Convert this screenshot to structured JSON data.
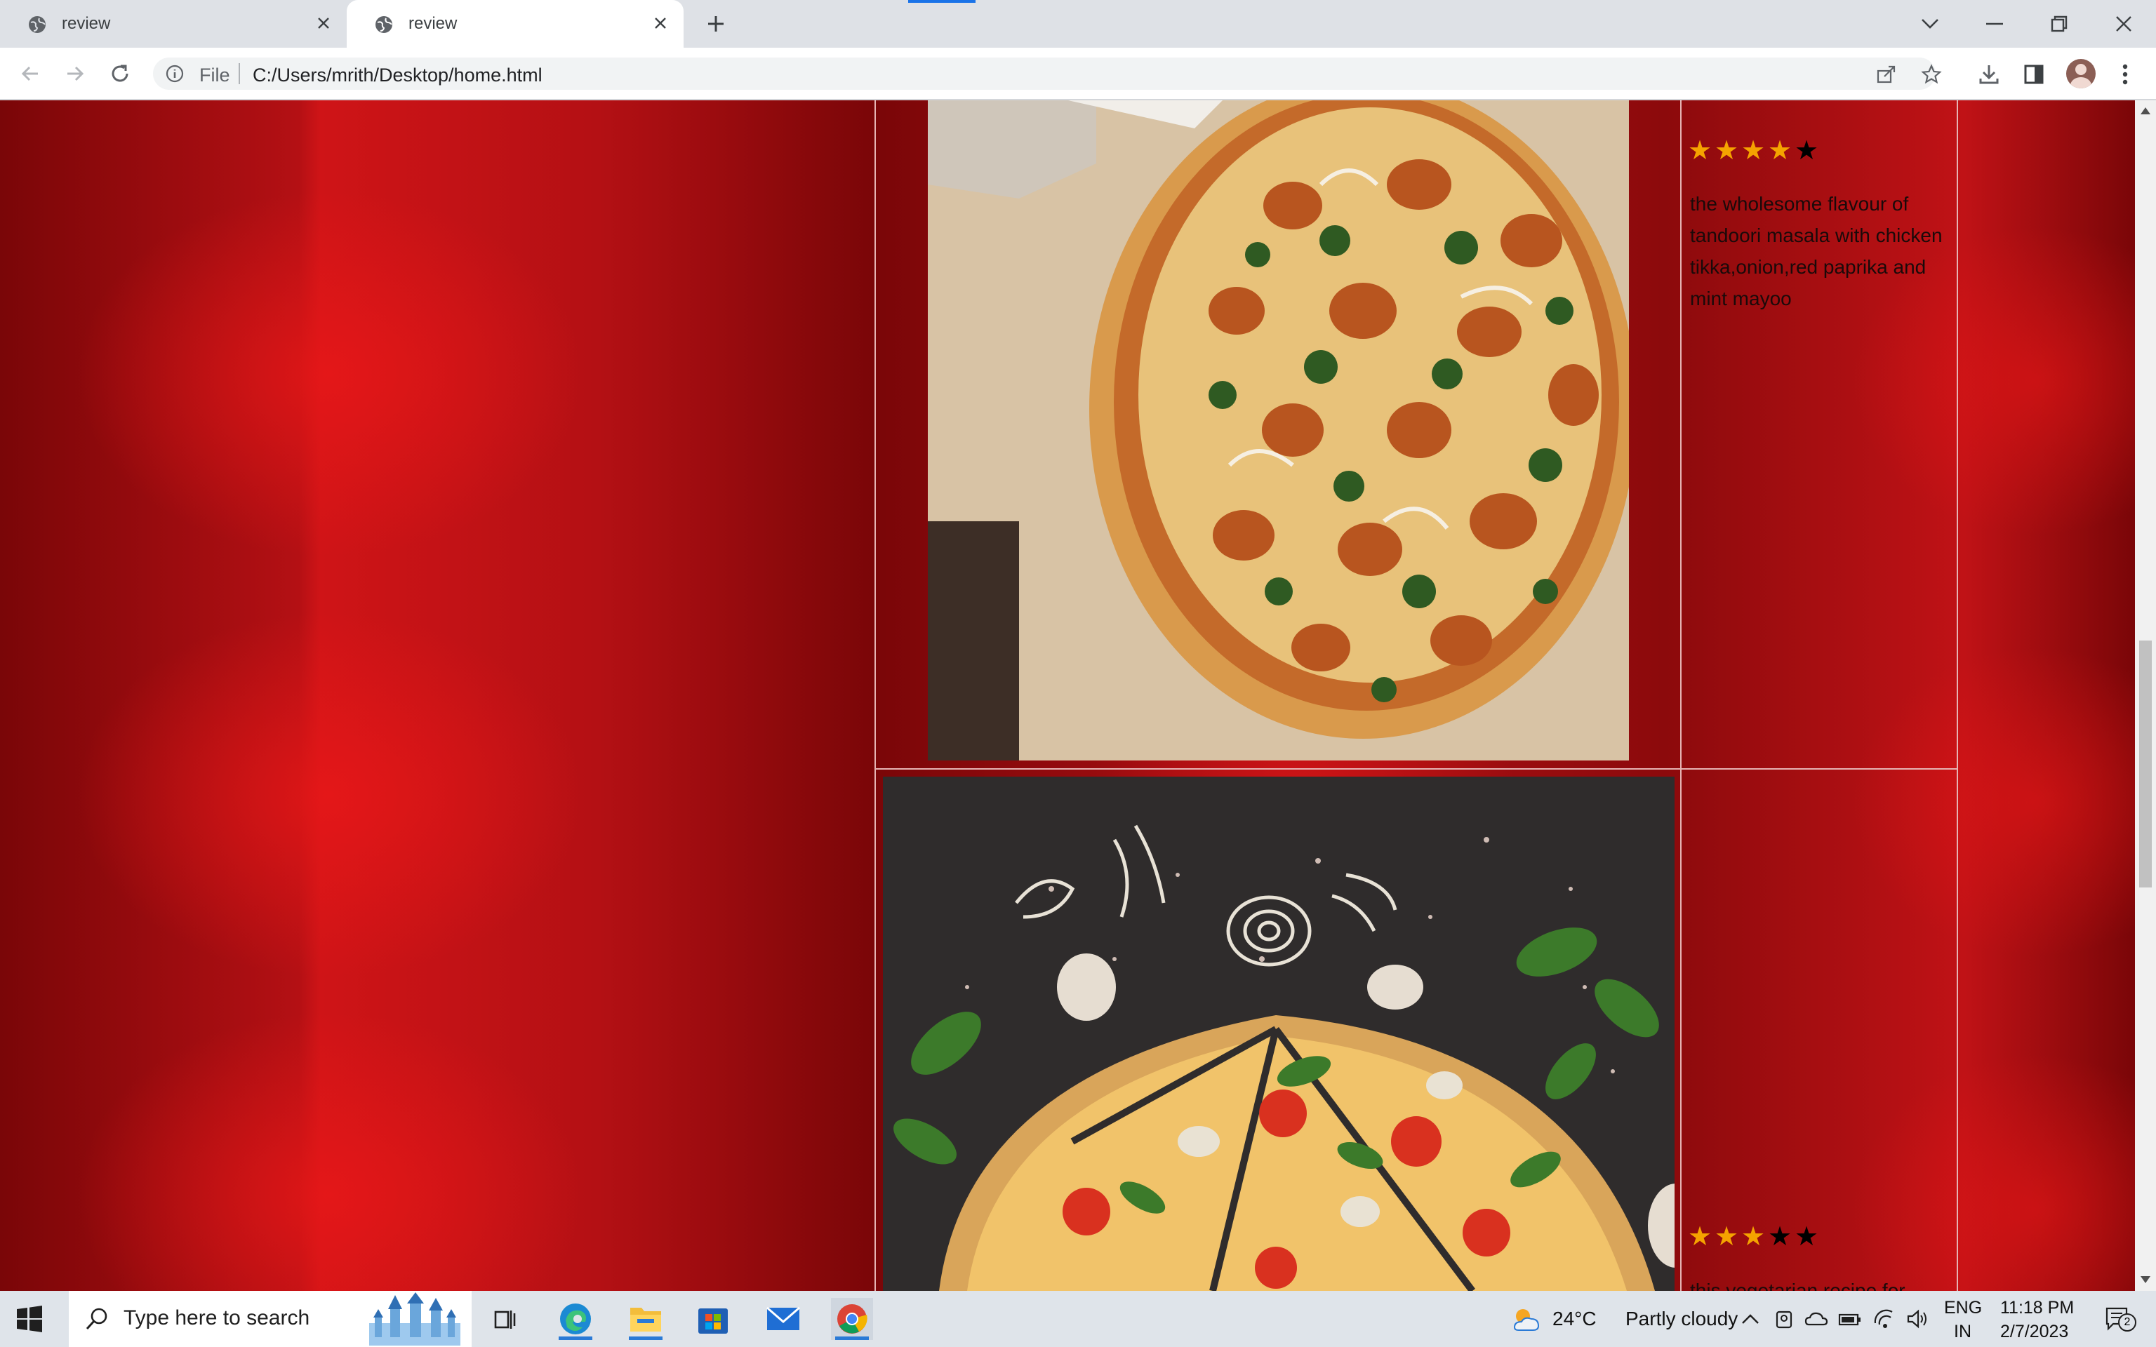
{
  "browser": {
    "tabs": [
      {
        "title": "review",
        "active": false
      },
      {
        "title": "review",
        "active": true
      }
    ],
    "address": {
      "scheme_label": "File",
      "url": "C:/Users/mrith/Desktop/home.html"
    }
  },
  "page": {
    "items": [
      {
        "rating": 4,
        "max_rating": 5,
        "description": "the wholesome flavour of tandoori masala with chicken tikka,onion,red paprika and mint mayoo"
      },
      {
        "rating": 3,
        "max_rating": 5,
        "description": "this vegetarian recipe for"
      }
    ]
  },
  "taskbar": {
    "search_placeholder": "Type here to search",
    "weather": {
      "temperature": "24°C",
      "condition": "Partly cloudy"
    },
    "language": {
      "code": "ENG",
      "region": "IN"
    },
    "clock": {
      "time": "11:18 PM",
      "date": "2/7/2023"
    },
    "notification_count": "2"
  },
  "colors": {
    "star_on": "#f5a300",
    "star_off": "#000000",
    "background_red": "#b30f12",
    "accent_blue": "#1a73e8"
  }
}
